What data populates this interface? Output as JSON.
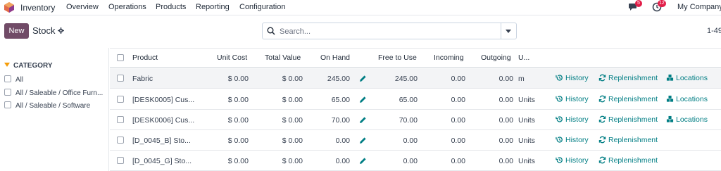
{
  "navbar": {
    "app_title": "Inventory",
    "menu": [
      "Overview",
      "Operations",
      "Products",
      "Reporting",
      "Configuration"
    ],
    "chat_badge": "5",
    "activity_badge": "12",
    "company": "My Company"
  },
  "control": {
    "new_label": "New",
    "title": "Stock",
    "search_placeholder": "Search...",
    "pager": "1-49"
  },
  "sidebar": {
    "header": "CATEGORY",
    "items": [
      "All",
      "All / Saleable / Office Furn...",
      "All / Saleable / Software"
    ]
  },
  "table": {
    "columns": [
      "Product",
      "Unit Cost",
      "Total Value",
      "On Hand",
      "Free to Use",
      "Incoming",
      "Outgoing",
      "U..."
    ],
    "rows": [
      {
        "product": "Fabric",
        "unit_cost": "$ 0.00",
        "total_value": "$ 0.00",
        "on_hand": "245.00",
        "free": "245.00",
        "incoming": "0.00",
        "outgoing": "0.00",
        "uom": "m",
        "locations": true
      },
      {
        "product": "[DESK0005] Cus...",
        "unit_cost": "$ 0.00",
        "total_value": "$ 0.00",
        "on_hand": "65.00",
        "free": "65.00",
        "incoming": "0.00",
        "outgoing": "0.00",
        "uom": "Units",
        "locations": true
      },
      {
        "product": "[DESK0006] Cus...",
        "unit_cost": "$ 0.00",
        "total_value": "$ 0.00",
        "on_hand": "70.00",
        "free": "70.00",
        "incoming": "0.00",
        "outgoing": "0.00",
        "uom": "Units",
        "locations": true
      },
      {
        "product": "[D_0045_B] Sto...",
        "unit_cost": "$ 0.00",
        "total_value": "$ 0.00",
        "on_hand": "0.00",
        "free": "0.00",
        "incoming": "0.00",
        "outgoing": "0.00",
        "uom": "Units",
        "locations": false
      },
      {
        "product": "[D_0045_G] Sto...",
        "unit_cost": "$ 0.00",
        "total_value": "$ 0.00",
        "on_hand": "0.00",
        "free": "0.00",
        "incoming": "0.00",
        "outgoing": "0.00",
        "uom": "Units",
        "locations": false
      }
    ],
    "actions": {
      "history": "History",
      "replenishment": "Replenishment",
      "locations": "Locations"
    }
  },
  "colors": {
    "brand": "#714b67",
    "link": "#017e84",
    "badge": "#e11d48",
    "filter_icon": "#f59e0b"
  }
}
